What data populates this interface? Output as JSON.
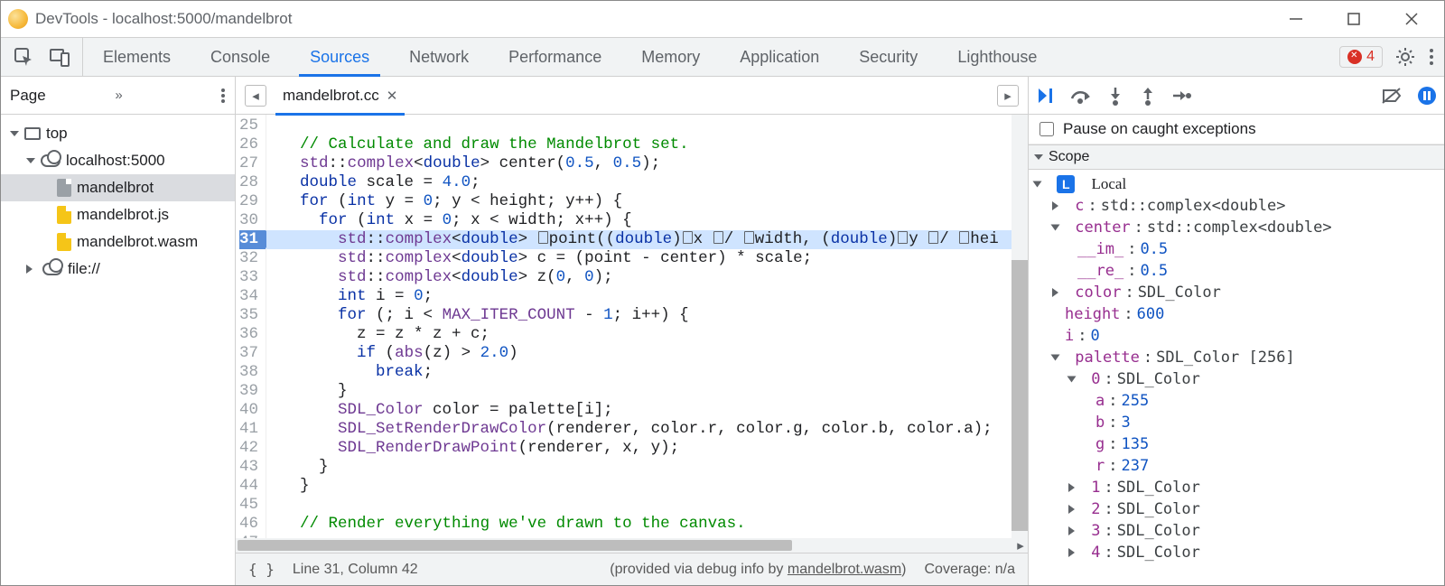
{
  "window": {
    "title": "DevTools - localhost:5000/mandelbrot"
  },
  "tabs": [
    "Elements",
    "Console",
    "Sources",
    "Network",
    "Performance",
    "Memory",
    "Application",
    "Security",
    "Lighthouse"
  ],
  "active_tab": "Sources",
  "error_count": "4",
  "page_panel": {
    "label": "Page",
    "tree": {
      "top": "top",
      "host": "localhost:5000",
      "files": [
        "mandelbrot",
        "mandelbrot.js",
        "mandelbrot.wasm"
      ],
      "file_scheme": "file://"
    }
  },
  "editor": {
    "tab_name": "mandelbrot.cc",
    "first_line": 25,
    "current_line": 31,
    "lines": [
      "",
      "  // Calculate and draw the Mandelbrot set.",
      "  std::complex<double> center(0.5, 0.5);",
      "  double scale = 4.0;",
      "  for (int y = 0; y < height; y++) {",
      "    for (int x = 0; x < width; x++) {",
      "      std::complex<double> ▯point((double)▯x ▯/ ▯width, (double)▯y ▯/ ▯hei",
      "      std::complex<double> c = (point - center) * scale;",
      "      std::complex<double> z(0, 0);",
      "      int i = 0;",
      "      for (; i < MAX_ITER_COUNT - 1; i++) {",
      "        z = z * z + c;",
      "        if (abs(z) > 2.0)",
      "          break;",
      "      }",
      "      SDL_Color color = palette[i];",
      "      SDL_SetRenderDrawColor(renderer, color.r, color.g, color.b, color.a);",
      "      SDL_RenderDrawPoint(renderer, x, y);",
      "    }",
      "  }",
      "",
      "  // Render everything we've drawn to the canvas.",
      ""
    ]
  },
  "status": {
    "pos": "Line 31, Column 42",
    "debug_info_prefix": "(provided via debug info by ",
    "debug_info_link": "mandelbrot.wasm",
    "debug_info_suffix": ")",
    "coverage": "Coverage: n/a"
  },
  "debugger": {
    "pause_label": "Pause on caught exceptions",
    "scope_label": "Scope",
    "local_label": "Local",
    "vars": {
      "c": "std::complex<double>",
      "center": "std::complex<double>",
      "center_im": "0.5",
      "center_re": "0.5",
      "color": "SDL_Color",
      "height_k": "height",
      "height_v": "600",
      "i_k": "i",
      "i_v": "0",
      "palette": "SDL_Color [256]",
      "pal0": "SDL_Color",
      "pal0_a": "255",
      "pal0_b": "3",
      "pal0_g": "135",
      "pal0_r": "237",
      "pal1": "SDL_Color",
      "pal2": "SDL_Color",
      "pal3": "SDL_Color",
      "pal4": "SDL_Color"
    }
  }
}
